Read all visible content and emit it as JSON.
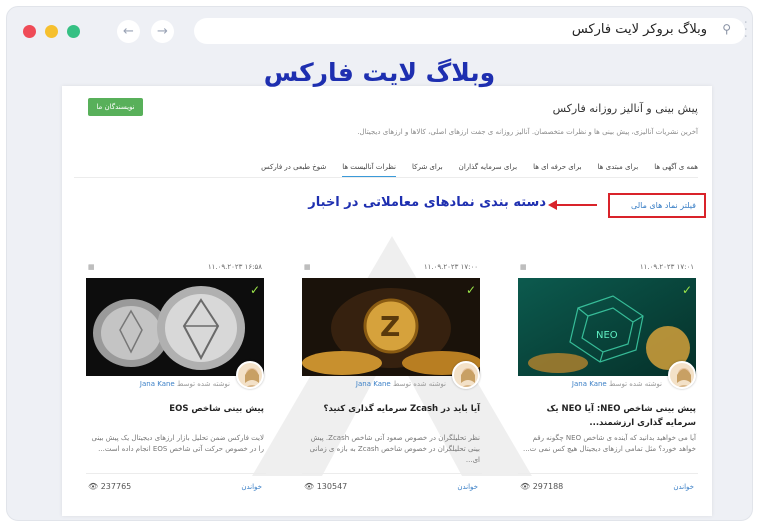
{
  "browser": {
    "url": "وبلاگ بروکر لایت فارکس",
    "colors": {
      "red": "#ef4b57",
      "yellow": "#f6c02e",
      "green": "#35c083"
    }
  },
  "overlay_title": "وبلاگ لایت فارکس",
  "header": {
    "writers_button": "نویسندگان ما",
    "title": "پیش بینی و آنالیز روزانه فارکس",
    "subtitle": "آخرین نشریات آنالیزی، پیش بینی ها و نظرات متخصصان. آنالیز روزانه ی جفت ارزهای اصلی، کالاها و ارزهای دیجیتال."
  },
  "tabs": [
    "همه ی آگهی ها",
    "برای مبتدی ها",
    "برای حرفه ای ها",
    "برای سرمایه گذاران",
    "برای شرکا",
    "نظرات آنالیست ها",
    "شوخ طبعی در فارکس"
  ],
  "filter_label": "فیلتر نماد های مالی",
  "annotation": "دسته بندی نمادهای معاملاتی در اخبار",
  "cards": [
    {
      "date": "۱۱.۰۹.۲۰۲۳ ۱۷:۰۱",
      "author_prefix": "نوشته شده توسط",
      "author": "Jana Kane",
      "title": "پیش بینی شاخص NEO: آیا NEO یک سرمایه گذاری ارزشمند...",
      "excerpt": "آیا می خواهید بدانید که آینده ی شاخص NEO چگونه رقم خواهد خورد؟ مثل تمامی ارزهای دیجیتال هیچ کس نمی ت...",
      "more": "خواندن",
      "views": "297188"
    },
    {
      "date": "۱۱.۰۹.۲۰۲۳ ۱۷:۰۰",
      "author_prefix": "نوشته شده توسط",
      "author": "Jana Kane",
      "title": "آیا باید در Zcash سرمایه گذاری کنید؟",
      "excerpt": "نظر تحلیلگران در خصوص صعود آتی شاخص Zcash. پیش بینی تحلیلگران در خصوص شاخص Zcash به بازه ی زمانی ای...",
      "more": "خواندن",
      "views": "130547"
    },
    {
      "date": "۱۱.۰۹.۲۰۲۳ ۱۶:۵۸",
      "author_prefix": "نوشته شده توسط",
      "author": "Jana Kane",
      "title": "پیش بینی شاخص EOS",
      "excerpt": "لایت فارکس ضمن تحلیل بازار ارزهای دیجیتال یک پیش بینی را در خصوص حرکت آتی شاخص EOS انجام داده است...",
      "more": "خواندن",
      "views": "237765"
    }
  ]
}
